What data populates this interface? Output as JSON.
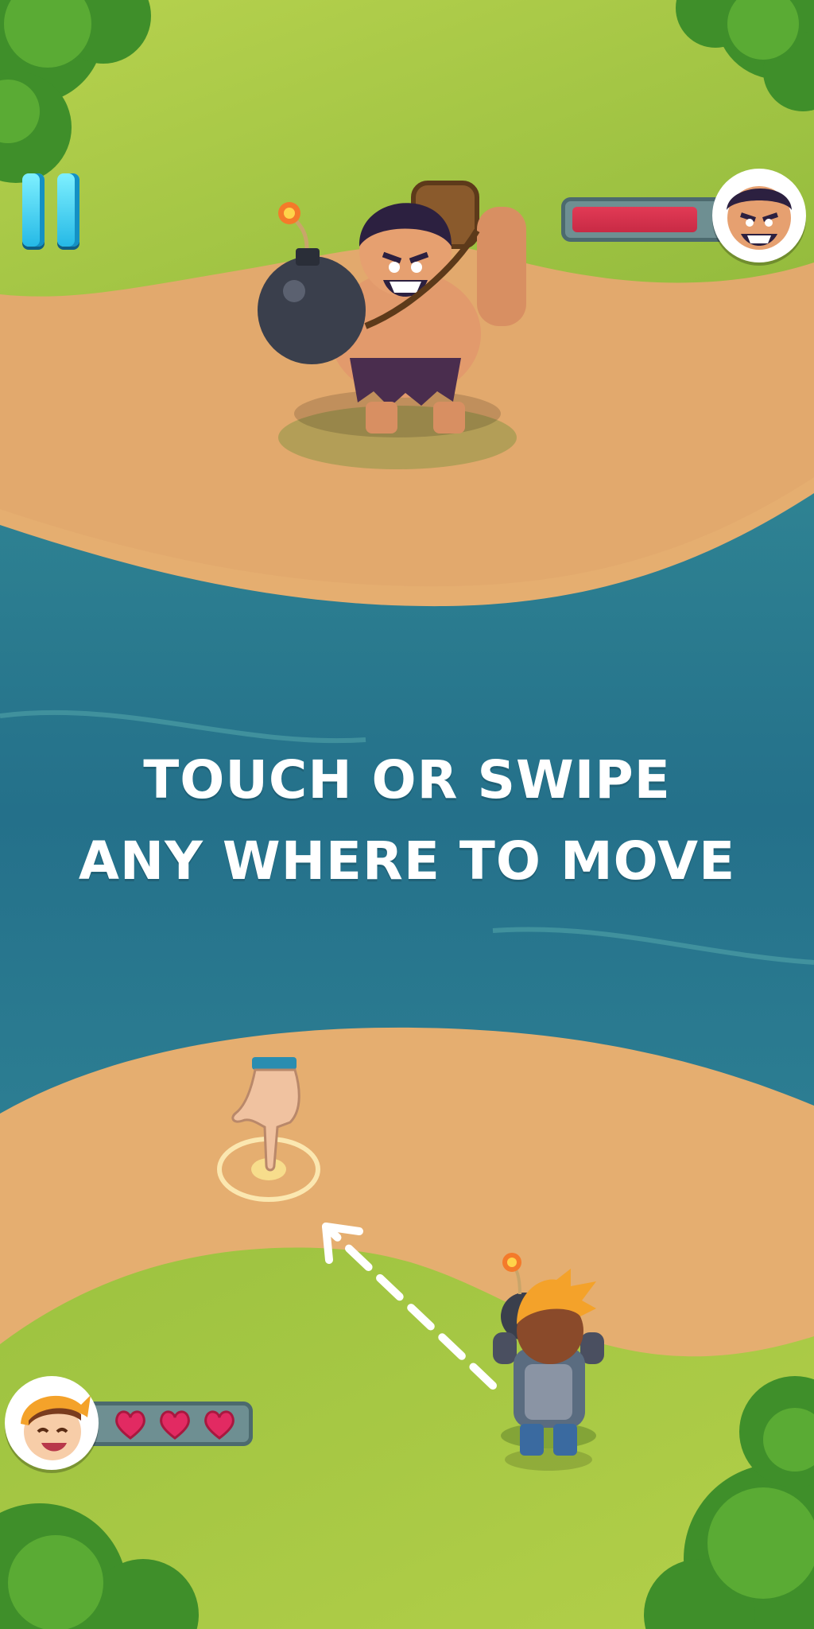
{
  "hud": {
    "pause_icon": "pause-icon",
    "enemy_health_fraction": 0.82,
    "enemy_avatar_icon": "caveman-face-icon",
    "player_avatar_icon": "boy-face-icon",
    "player_hearts": 3,
    "heart_icon": "heart-icon"
  },
  "tutorial": {
    "line1": "TOUCH OR SWIPE",
    "line2": "ANY WHERE TO MOVE",
    "hand_icon": "pointing-hand-icon",
    "arrow_icon": "dashed-arrow-icon"
  },
  "colors": {
    "health_bar": "#e23a55",
    "hud_panel": "#6e8f92",
    "heart": "#e22a62",
    "water": "#2b7087",
    "sand": "#e3ac70",
    "grass": "#a9c94a"
  }
}
